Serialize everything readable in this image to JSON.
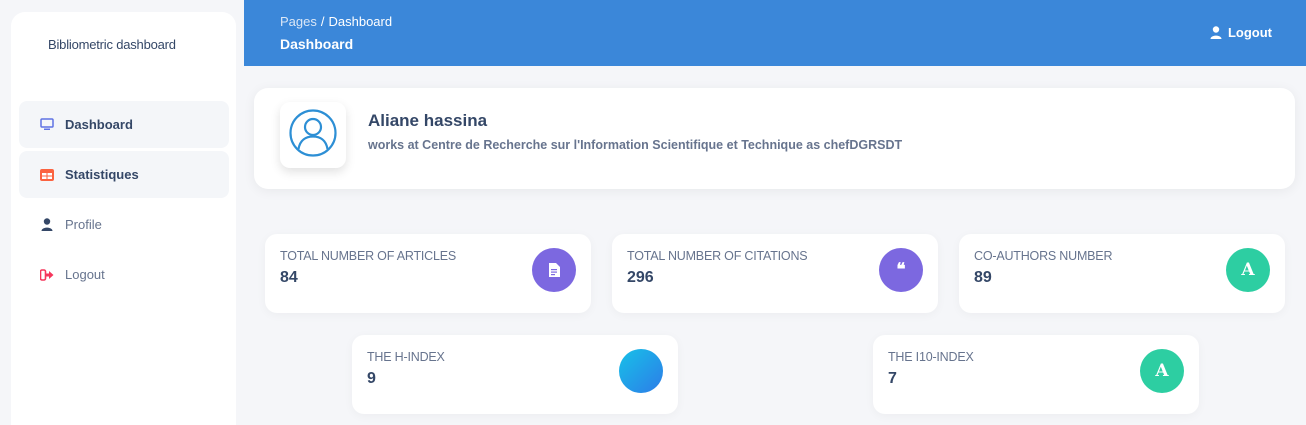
{
  "sidebar": {
    "brand": "Bibliometric dashboard",
    "items": [
      {
        "label": "Dashboard",
        "icon": "monitor-icon"
      },
      {
        "label": "Statistiques",
        "icon": "table-icon"
      },
      {
        "label": "Profile",
        "icon": "user-icon"
      },
      {
        "label": "Logout",
        "icon": "sign-out-icon"
      }
    ]
  },
  "header": {
    "breadcrumb_root": "Pages",
    "breadcrumb_separator": "/",
    "breadcrumb_current": "Dashboard",
    "title": "Dashboard",
    "logout_label": "Logout"
  },
  "profile": {
    "name": "Aliane hassina",
    "description": "works at Centre de Recherche sur l'Information Scientifique et Technique as chefDGRSDT",
    "avatar_icon": "user-circle-icon"
  },
  "stats": [
    {
      "label": "TOTAL NUMBER OF ARTICLES",
      "value": "84",
      "icon": "document-icon",
      "icon_color": "#7c68e0"
    },
    {
      "label": "TOTAL NUMBER OF CITATIONS",
      "value": "296",
      "icon": "quote-icon",
      "icon_color": "#7c68e0",
      "icon_text": "❝"
    },
    {
      "label": "CO-AUTHORS NUMBER",
      "value": "89",
      "icon": "letter-a-icon",
      "icon_color": "#2dcea2",
      "icon_text": "A"
    },
    {
      "label": "THE H-INDEX",
      "value": "9",
      "icon": "gradient-circle-icon",
      "icon_color": "#17c1e8"
    },
    {
      "label": "THE I10-INDEX",
      "value": "7",
      "icon": "letter-a-icon",
      "icon_color": "#2dcea2",
      "icon_text": "A"
    }
  ],
  "colors": {
    "header_bg": "#3b87d9",
    "text_dark": "#344767",
    "text_muted": "#67748e",
    "accent_purple": "#7c68e0",
    "accent_green": "#2dcea2",
    "logout_red": "#f5365c",
    "stats_orange": "#fb6340"
  }
}
